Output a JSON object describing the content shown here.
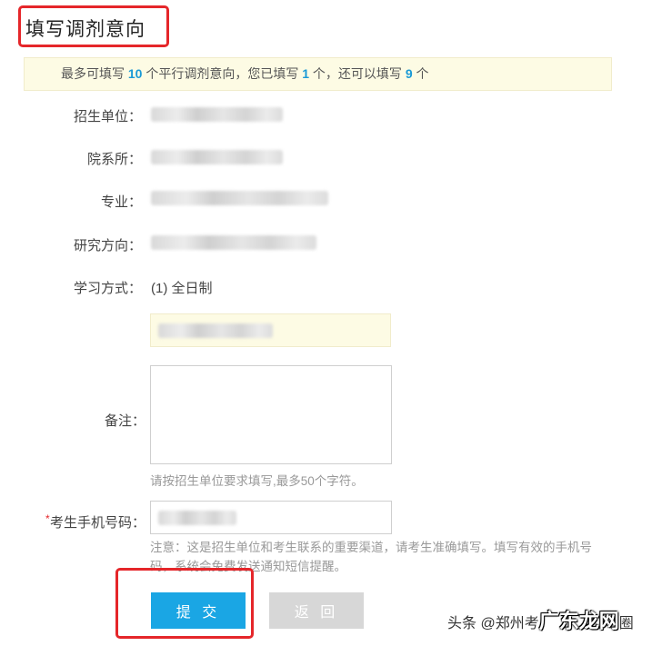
{
  "page": {
    "title": "填写调剂意向"
  },
  "notice": {
    "part1": "最多可填写 ",
    "max": "10",
    "part2": " 个平行调剂意向，您已填写 ",
    "filled": "1",
    "part3": " 个，还可以填写 ",
    "remaining": "9",
    "part4": " 个"
  },
  "form": {
    "school_label": "招生单位：",
    "department_label": "院系所：",
    "major_label": "专业：",
    "direction_label": "研究方向：",
    "study_mode_label": "学习方式：",
    "study_mode_value": "(1) 全日制",
    "remark_label": "备注：",
    "remark_hint": "请按招生单位要求填写,最多50个字符。",
    "phone_required_mark": "*",
    "phone_label": "考生手机号码：",
    "phone_note": "注意：这是招生单位和考生联系的重要渠道，请考生准确填写。填写有效的手机号码，系统会免费发送通知短信提醒。"
  },
  "buttons": {
    "submit": "提 交",
    "back": "返 回"
  },
  "watermark": {
    "prefix": "头条 @郑州考",
    "logo": "广东龙网",
    "suffix": "圈"
  },
  "colors": {
    "accent": "#1aa6e4",
    "highlight": "#e5262a",
    "notice_bg": "#fdfbe4"
  }
}
